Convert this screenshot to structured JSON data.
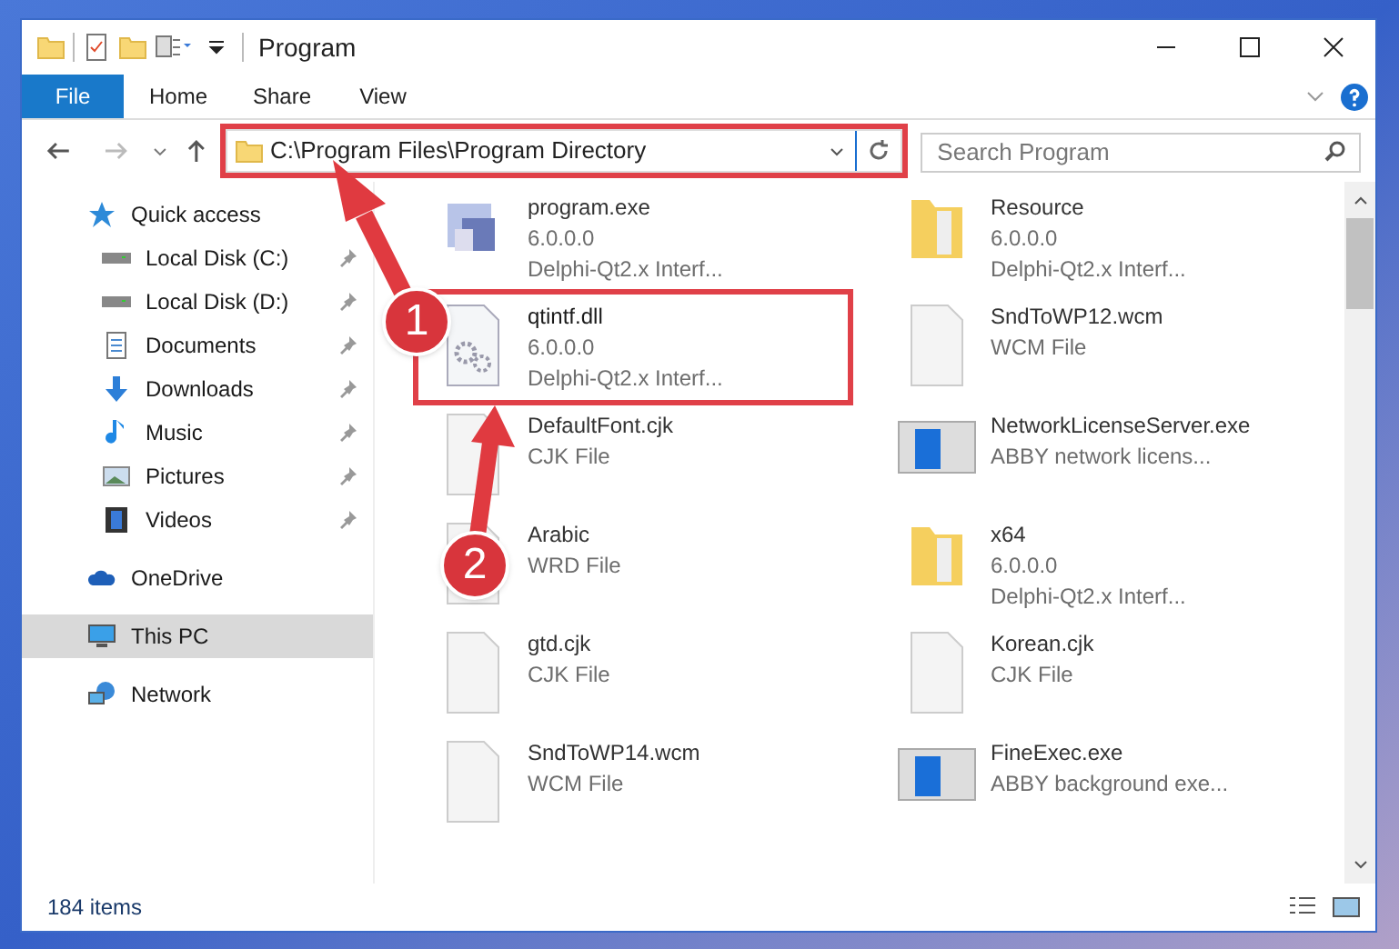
{
  "window": {
    "title": "Program"
  },
  "ribbon_tabs": [
    {
      "label": "File",
      "selected": true
    },
    {
      "label": "Home",
      "selected": false
    },
    {
      "label": "Share",
      "selected": false
    },
    {
      "label": "View",
      "selected": false
    }
  ],
  "address": {
    "path": "C:\\Program Files\\Program Directory",
    "highlighted": true
  },
  "search": {
    "placeholder": "Search Program"
  },
  "sidebar": {
    "items": [
      {
        "label": "Quick access",
        "kind": "star",
        "pinned": false,
        "selected": false,
        "children": [
          {
            "label": "Local Disk (C:)",
            "kind": "disk",
            "pinned": true,
            "selected": false
          },
          {
            "label": "Local Disk (D:)",
            "kind": "disk",
            "pinned": true,
            "selected": false
          },
          {
            "label": "Documents",
            "kind": "doc",
            "pinned": true,
            "selected": false
          },
          {
            "label": "Downloads",
            "kind": "download",
            "pinned": true,
            "selected": false
          },
          {
            "label": "Music",
            "kind": "music",
            "pinned": true,
            "selected": false
          },
          {
            "label": "Pictures",
            "kind": "pictures",
            "pinned": true,
            "selected": false
          },
          {
            "label": "Videos",
            "kind": "video",
            "pinned": true,
            "selected": false
          }
        ]
      },
      {
        "label": "OneDrive",
        "kind": "cloud",
        "pinned": false,
        "selected": false
      },
      {
        "label": "This PC",
        "kind": "pc",
        "pinned": false,
        "selected": true
      },
      {
        "label": "Network",
        "kind": "network",
        "pinned": false,
        "selected": false
      }
    ]
  },
  "files": [
    {
      "name": "program.exe",
      "kind": "app",
      "lines": [
        "6.0.0.0",
        "Delphi-Qt2.x Interf..."
      ],
      "highlighted": false
    },
    {
      "name": "Resource",
      "kind": "folder",
      "lines": [
        "6.0.0.0",
        "Delphi-Qt2.x Interf..."
      ],
      "highlighted": false
    },
    {
      "name": "qtintf.dll",
      "kind": "gears",
      "lines": [
        "6.0.0.0",
        "Delphi-Qt2.x Interf..."
      ],
      "highlighted": true
    },
    {
      "name": "SndToWP12.wcm",
      "kind": "file",
      "lines": [
        "WCM File"
      ],
      "highlighted": false
    },
    {
      "name": "DefaultFont.cjk",
      "kind": "file",
      "lines": [
        "CJK File"
      ],
      "highlighted": false
    },
    {
      "name": "NetworkLicenseServer.exe",
      "kind": "window",
      "lines": [
        "ABBY network licens..."
      ],
      "highlighted": false
    },
    {
      "name": "Arabic",
      "kind": "file",
      "lines": [
        "WRD File"
      ],
      "highlighted": false
    },
    {
      "name": "x64",
      "kind": "folder",
      "lines": [
        "6.0.0.0",
        "Delphi-Qt2.x Interf..."
      ],
      "highlighted": false
    },
    {
      "name": "gtd.cjk",
      "kind": "file",
      "lines": [
        "CJK File"
      ],
      "highlighted": false
    },
    {
      "name": "Korean.cjk",
      "kind": "file",
      "lines": [
        "CJK File"
      ],
      "highlighted": false
    },
    {
      "name": "SndToWP14.wcm",
      "kind": "file",
      "lines": [
        "WCM File"
      ],
      "highlighted": false
    },
    {
      "name": "FineExec.exe",
      "kind": "window",
      "lines": [
        "ABBY background exe..."
      ],
      "highlighted": false
    }
  ],
  "status_bar": {
    "count": "184 items"
  },
  "callouts": [
    {
      "label": "1"
    },
    {
      "label": "2"
    }
  ]
}
